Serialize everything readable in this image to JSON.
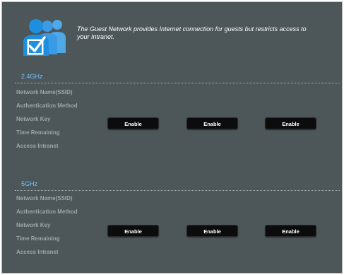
{
  "intro_text": "The Guest Network provides Internet connection for guests but restricts access to your Intranet.",
  "bands": [
    {
      "band_label": "2.4GHz",
      "fields": [
        "Network Name(SSID)",
        "Authentication Method",
        "Network Key",
        "Time Remaining",
        "Access Intranet"
      ],
      "buttons": [
        "Enable",
        "Enable",
        "Enable"
      ]
    },
    {
      "band_label": "5GHz",
      "fields": [
        "Network Name(SSID)",
        "Authentication Method",
        "Network Key",
        "Time Remaining",
        "Access Intranet"
      ],
      "buttons": [
        "Enable",
        "Enable",
        "Enable"
      ]
    }
  ],
  "colors": {
    "panel_background": "#4d5659",
    "band_label": "#6cc3ff",
    "field_label": "#9ca6aa",
    "button_background": "#0c0c0c",
    "icon_blue": "#1e8fe0"
  },
  "icons": [
    "guest-network-users-icon",
    "checkmark-icon"
  ]
}
